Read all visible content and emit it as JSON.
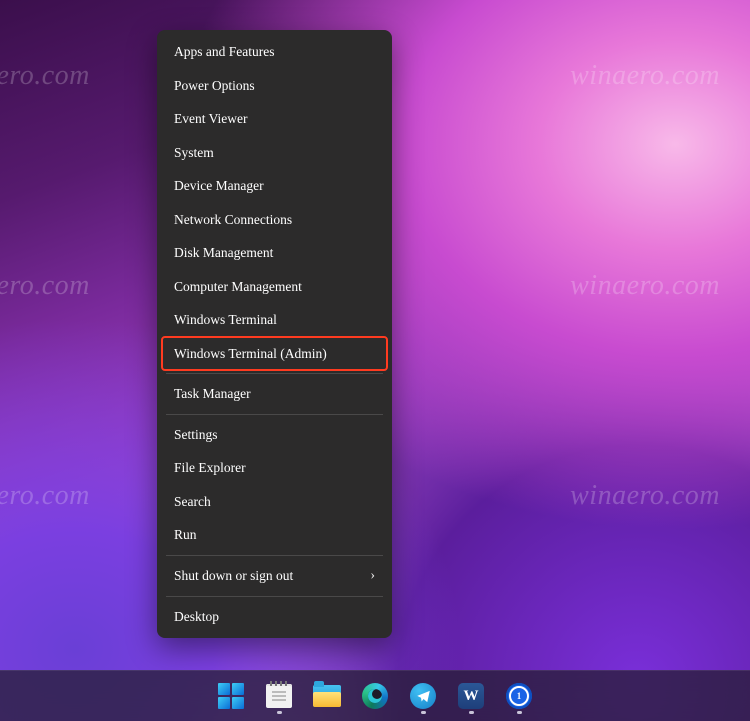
{
  "watermark_text": "winaero.com",
  "context_menu": {
    "items": [
      {
        "label": "Apps and Features",
        "highlighted": false,
        "submenu": false
      },
      {
        "label": "Power Options",
        "highlighted": false,
        "submenu": false
      },
      {
        "label": "Event Viewer",
        "highlighted": false,
        "submenu": false
      },
      {
        "label": "System",
        "highlighted": false,
        "submenu": false
      },
      {
        "label": "Device Manager",
        "highlighted": false,
        "submenu": false
      },
      {
        "label": "Network Connections",
        "highlighted": false,
        "submenu": false
      },
      {
        "label": "Disk Management",
        "highlighted": false,
        "submenu": false
      },
      {
        "label": "Computer Management",
        "highlighted": false,
        "submenu": false
      },
      {
        "label": "Windows Terminal",
        "highlighted": false,
        "submenu": false
      },
      {
        "label": "Windows Terminal (Admin)",
        "highlighted": true,
        "submenu": false
      },
      {
        "label": "Task Manager",
        "highlighted": false,
        "submenu": false,
        "sep_before": true
      },
      {
        "label": "Settings",
        "highlighted": false,
        "submenu": false,
        "sep_before": true
      },
      {
        "label": "File Explorer",
        "highlighted": false,
        "submenu": false
      },
      {
        "label": "Search",
        "highlighted": false,
        "submenu": false
      },
      {
        "label": "Run",
        "highlighted": false,
        "submenu": false
      },
      {
        "label": "Shut down or sign out",
        "highlighted": false,
        "submenu": true,
        "sep_before": true
      },
      {
        "label": "Desktop",
        "highlighted": false,
        "submenu": false,
        "sep_before": true
      }
    ]
  },
  "taskbar": {
    "items": [
      {
        "name": "start",
        "running": false
      },
      {
        "name": "notes",
        "running": true
      },
      {
        "name": "file-explorer",
        "running": false
      },
      {
        "name": "edge",
        "running": false
      },
      {
        "name": "telegram",
        "running": true
      },
      {
        "name": "word",
        "running": true,
        "glyph": "W"
      },
      {
        "name": "onepassword",
        "running": true,
        "glyph": "1"
      }
    ]
  }
}
